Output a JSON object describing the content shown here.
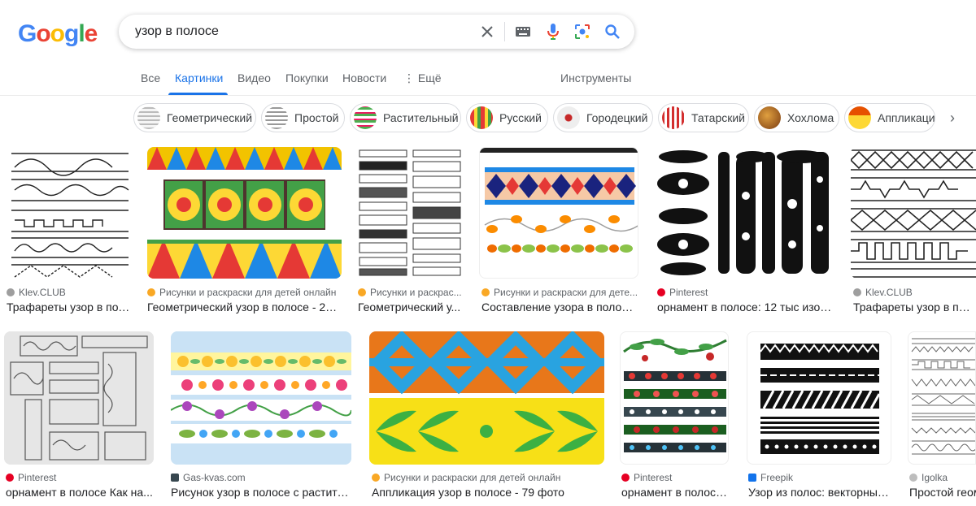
{
  "logo": {
    "text": "Google"
  },
  "search": {
    "query": "узор в полосе"
  },
  "tabs": [
    {
      "label": "Все"
    },
    {
      "label": "Картинки"
    },
    {
      "label": "Видео"
    },
    {
      "label": "Покупки"
    },
    {
      "label": "Новости"
    },
    {
      "label": "Ещё"
    }
  ],
  "tools": {
    "label": "Инструменты"
  },
  "chips": [
    {
      "label": "Геометрический"
    },
    {
      "label": "Простой"
    },
    {
      "label": "Растительный"
    },
    {
      "label": "Русский"
    },
    {
      "label": "Городецкий"
    },
    {
      "label": "Татарский"
    },
    {
      "label": "Хохлома"
    },
    {
      "label": "Аппликация"
    }
  ],
  "results": [
    {
      "source": "Klev.CLUB",
      "caption": "Трафареты узор в пол..."
    },
    {
      "source": "Рисунки и раскраски для детей онлайн",
      "caption": "Геометрический узор в полосе - 22 ..."
    },
    {
      "source": "Рисунки и раскрас...",
      "caption": "Геометрический у..."
    },
    {
      "source": "Рисунки и раскраски для дете...",
      "caption": "Составление узора в полосе..."
    },
    {
      "source": "Pinterest",
      "caption": "орнамент в полосе: 12 тыс изоб..."
    },
    {
      "source": "Klev.CLUB",
      "caption": "Трафареты узор в пол..."
    },
    {
      "source": "Pinterest",
      "caption": "орнамент в полосе Как на..."
    },
    {
      "source": "Gas-kvas.com",
      "caption": "Рисунок узор в полосе с растител..."
    },
    {
      "source": "Рисунки и раскраски для детей онлайн",
      "caption": "Аппликация узор в полосе - 79 фото"
    },
    {
      "source": "Pinterest",
      "caption": "орнамент в полосе..."
    },
    {
      "source": "Freepik",
      "caption": "Узор из полос: векторные..."
    },
    {
      "source": "Igolka",
      "caption": "Простой геом"
    }
  ],
  "colors": {
    "accent": "#1a73e8",
    "google_blue": "#4285f4",
    "google_red": "#ea4335",
    "google_yellow": "#fbbc05",
    "google_green": "#34a853"
  }
}
